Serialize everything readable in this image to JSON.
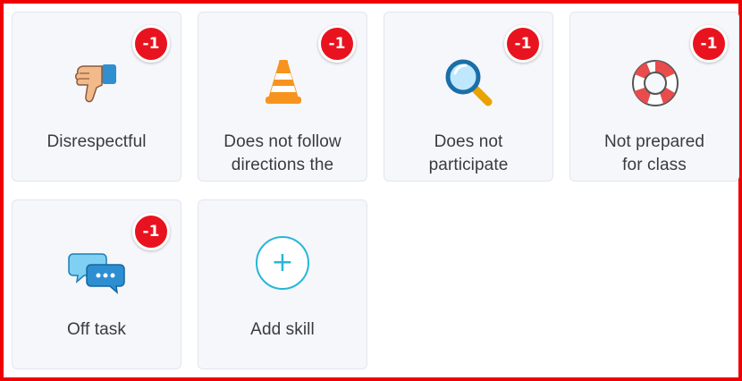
{
  "skills": [
    {
      "label": "Disrespectful",
      "badge": "-1",
      "icon": "thumbs-down-icon"
    },
    {
      "label": "Does not follow\ndirections the",
      "badge": "-1",
      "icon": "traffic-cone-icon"
    },
    {
      "label": "Does not\nparticipate",
      "badge": "-1",
      "icon": "magnifying-glass-icon"
    },
    {
      "label": "Not prepared\nfor class",
      "badge": "-1",
      "icon": "life-ring-icon"
    },
    {
      "label": "Off task",
      "badge": "-1",
      "icon": "chat-bubbles-icon"
    }
  ],
  "add_skill": {
    "label": "Add skill",
    "icon": "plus-icon",
    "symbol": "+"
  },
  "colors": {
    "badge": "#e8131f",
    "accent": "#27b6d9",
    "frame": "#f00000",
    "tile": "#f6f7fb"
  }
}
